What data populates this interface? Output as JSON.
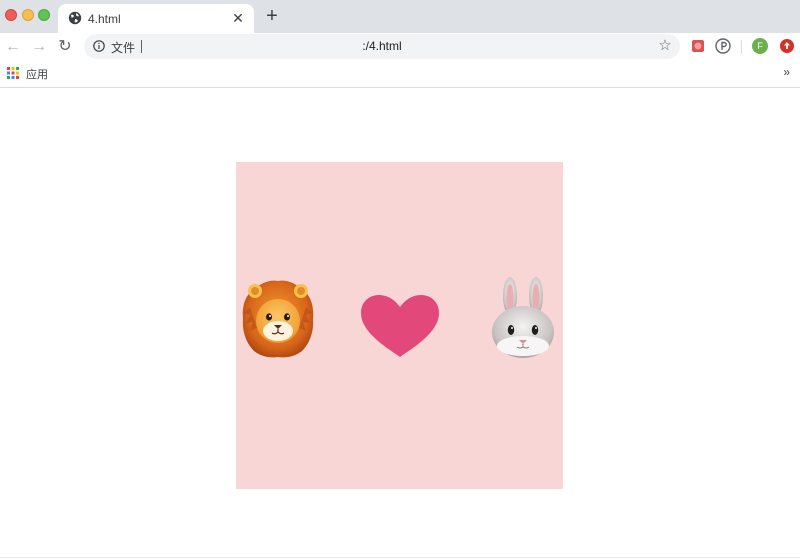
{
  "browser": {
    "tab": {
      "title": "4.html",
      "close_glyph": "✕",
      "favicon": "globe-icon"
    },
    "new_tab_glyph": "+",
    "nav": {
      "back_glyph": "←",
      "forward_glyph": "→",
      "reload_glyph": "↻"
    },
    "omnibox": {
      "label": "文件",
      "url": ":/4.html",
      "star_glyph": "☆"
    },
    "extensions": {
      "avatar_letter": "F"
    },
    "bookmarks": {
      "apps_label": "应用",
      "overflow_glyph": "»"
    }
  },
  "page": {
    "background": "#f8d6d6",
    "emojis": [
      "lion-face",
      "heart",
      "rabbit-face"
    ],
    "heart_color": "#e2497a"
  }
}
